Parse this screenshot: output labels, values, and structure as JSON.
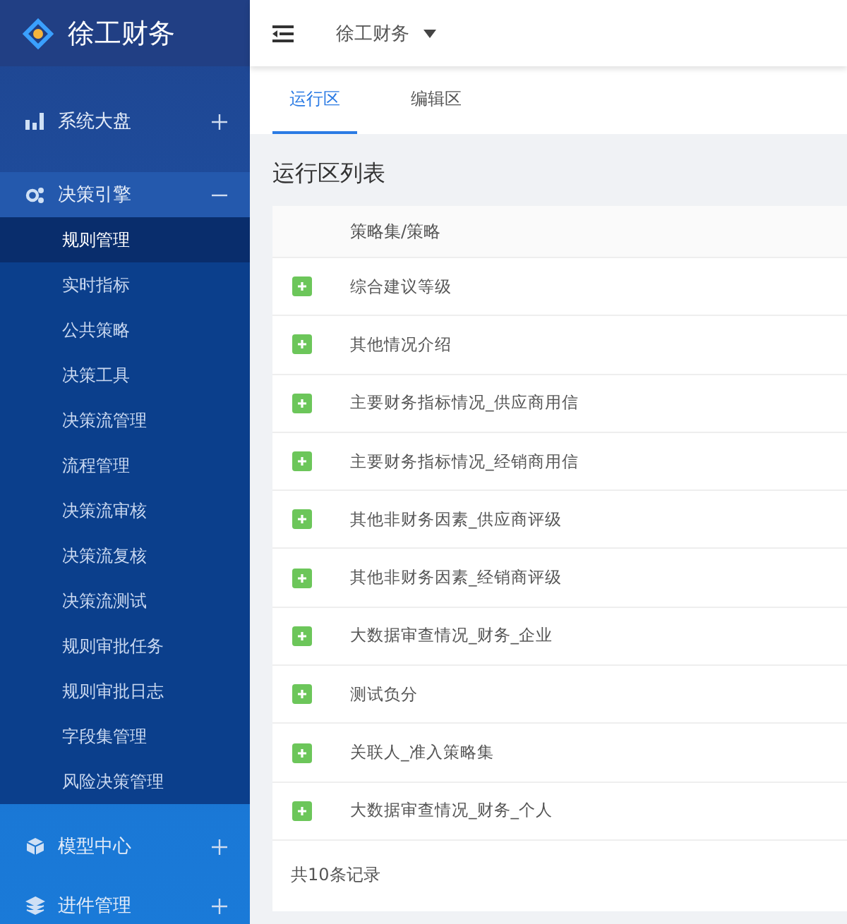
{
  "brand": {
    "name": "徐工财务"
  },
  "sidebar": {
    "groups": [
      {
        "label": "系统大盘",
        "expanded": false
      },
      {
        "label": "决策引擎",
        "expanded": true,
        "children": [
          {
            "label": "规则管理",
            "selected": true
          },
          {
            "label": "实时指标",
            "selected": false
          },
          {
            "label": "公共策略",
            "selected": false
          },
          {
            "label": "决策工具",
            "selected": false
          },
          {
            "label": "决策流管理",
            "selected": false
          },
          {
            "label": "流程管理",
            "selected": false
          },
          {
            "label": "决策流审核",
            "selected": false
          },
          {
            "label": "决策流复核",
            "selected": false
          },
          {
            "label": "决策流测试",
            "selected": false
          },
          {
            "label": "规则审批任务",
            "selected": false
          },
          {
            "label": "规则审批日志",
            "selected": false
          },
          {
            "label": "字段集管理",
            "selected": false
          },
          {
            "label": "风险决策管理",
            "selected": false
          }
        ]
      },
      {
        "label": "模型中心",
        "expanded": false
      },
      {
        "label": "进件管理",
        "expanded": false
      }
    ]
  },
  "topbar": {
    "org_selector": "徐工财务"
  },
  "tabs": [
    {
      "label": "运行区",
      "selected": true
    },
    {
      "label": "编辑区",
      "selected": false
    }
  ],
  "panel": {
    "title": "运行区列表"
  },
  "table": {
    "columns": [
      "策略集/策略"
    ],
    "rows": [
      {
        "name": "综合建议等级",
        "expanded": false
      },
      {
        "name": "其他情况介绍",
        "expanded": false
      },
      {
        "name": "主要财务指标情况_供应商用信",
        "expanded": false
      },
      {
        "name": "主要财务指标情况_经销商用信",
        "expanded": false
      },
      {
        "name": "其他非财务因素_供应商评级",
        "expanded": false
      },
      {
        "name": "其他非财务因素_经销商评级",
        "expanded": false
      },
      {
        "name": "大数据审查情况_财务_企业",
        "expanded": false
      },
      {
        "name": "测试负分",
        "expanded": false
      },
      {
        "name": "关联人_准入策略集",
        "expanded": false
      },
      {
        "name": "大数据审查情况_财务_个人",
        "expanded": false
      }
    ],
    "footer": "共10条记录"
  }
}
